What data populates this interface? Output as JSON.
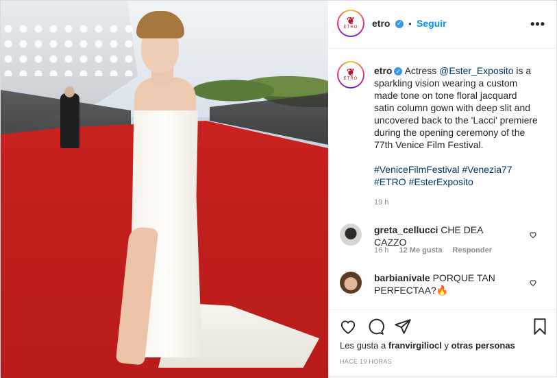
{
  "post": {
    "author": "etro",
    "follow_label": "Seguir",
    "more_label": "•••",
    "logo_text": "ETRO",
    "logo_bird": "❦",
    "verified_icon": "✓",
    "separator": "•",
    "caption": {
      "author": "etro",
      "prefix": "Actress ",
      "mention": "@Ester_Exposito",
      "body": " is a sparkling vision wearing a custom made tone on tone floral jacquard satin column gown with deep slit and uncovered back to the 'Lacci' premiere during the opening ceremony of the 77th Venice Film Festival.",
      "hashtags": "#VeniceFilmFestival #Venezia77 #ETRO #EsterExposito"
    },
    "caption_time": "19 h",
    "comments": [
      {
        "user": "greta_cellucci",
        "text": "CHE DEA CAZZO",
        "time": "16 h",
        "likes": "12 Me gusta",
        "reply": "Responder"
      },
      {
        "user": "barbianivale",
        "text": "PORQUE TAN PERFECTAA?",
        "emoji": "🔥"
      }
    ],
    "likes_prefix": "Les gusta a ",
    "likes_user": "franvirgiliocl",
    "likes_suffix": " y ",
    "likes_others": "otras personas",
    "posted_ago": "HACE 19 HORAS"
  },
  "colors": {
    "link": "#00376b",
    "follow": "#0095f6",
    "verified": "#3897f0",
    "brand": "#b3122b"
  }
}
